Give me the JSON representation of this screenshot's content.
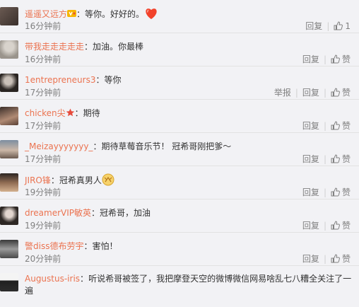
{
  "comments": [
    {
      "user": "遥遥又远方",
      "sep": "：",
      "text": "等你。好好的。",
      "time": "16分钟前",
      "reply": "回复",
      "like": "1",
      "report": ""
    },
    {
      "user": "带我走走走走走",
      "sep": "：",
      "text": "加油。你最棒",
      "time": "16分钟前",
      "reply": "回复",
      "like": "赞",
      "report": ""
    },
    {
      "user": "1entrepreneurs3",
      "sep": "：",
      "text": "等你",
      "time": "17分钟前",
      "reply": "回复",
      "like": "赞",
      "report": "举报"
    },
    {
      "user": "chicken尖",
      "sep": "：",
      "text": "期待",
      "time": "17分钟前",
      "reply": "回复",
      "like": "赞",
      "report": ""
    },
    {
      "user": "_Meizayyyyyyy_",
      "sep": "：",
      "text": "期待草莓音乐节！ 冠希哥刚把爹～",
      "time": "17分钟前",
      "reply": "回复",
      "like": "赞",
      "report": ""
    },
    {
      "user": "JIRO锋",
      "sep": "：",
      "text": "冠希真男人",
      "time": "19分钟前",
      "reply": "回复",
      "like": "赞",
      "report": ""
    },
    {
      "user": "dreamerVIP敏英",
      "sep": "：",
      "text": "冠希哥，加油",
      "time": "19分钟前",
      "reply": "回复",
      "like": "赞",
      "report": ""
    },
    {
      "user": "警diss德布劳宇",
      "sep": "：",
      "text": "害怕！",
      "time": "20分钟前",
      "reply": "回复",
      "like": "赞",
      "report": ""
    },
    {
      "user": "Augustus-iris",
      "sep": "：",
      "text": "听说希哥被签了，我把摩登天空的微博微信网易啥乱七八糟全关注了一遍",
      "time": "",
      "reply": "",
      "like": "",
      "report": ""
    }
  ],
  "colors": {
    "username": "#eb7350",
    "text": "#333333",
    "meta": "#808080"
  }
}
